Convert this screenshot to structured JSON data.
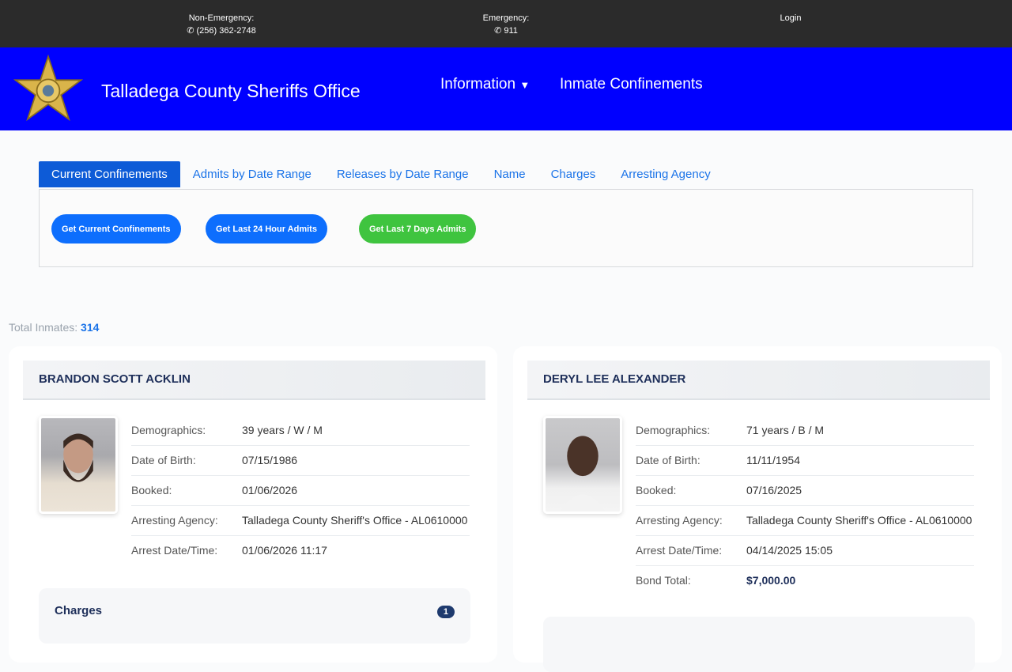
{
  "topbar": {
    "non_emergency_label": "Non-Emergency:",
    "non_emergency_phone": "(256) 362-2748",
    "emergency_label": "Emergency:",
    "emergency_phone": "911",
    "login": "Login"
  },
  "header": {
    "title": "Talladega County Sheriffs Office",
    "nav": [
      "Information",
      "Inmate Confinements"
    ]
  },
  "tabs": [
    "Current Confinements",
    "Admits by Date Range",
    "Releases by Date Range",
    "Name",
    "Charges",
    "Arresting Agency"
  ],
  "buttons": [
    {
      "label": "Get Current Confinements",
      "color": "#0d6efd"
    },
    {
      "label": "Get Last 24 Hour Admits",
      "color": "#0d6efd"
    },
    {
      "label": "Get Last 7 Days Admits",
      "color": "#3fc43f"
    }
  ],
  "total": {
    "label": "Total Inmates:",
    "value": "314"
  },
  "inmates": [
    {
      "name": "BRANDON SCOTT ACKLIN",
      "rows": [
        {
          "label": "Demographics:",
          "value": "39 years / W / M"
        },
        {
          "label": "Date of Birth:",
          "value": "07/15/1986"
        },
        {
          "label": "Booked:",
          "value": "01/06/2026"
        },
        {
          "label": "Arresting Agency:",
          "value": "Talladega County Sheriff's Office - AL0610000"
        },
        {
          "label": "Arrest Date/Time:",
          "value": "01/06/2026 11:17"
        }
      ],
      "charges_label": "Charges",
      "charges_count": "1"
    },
    {
      "name": "DERYL LEE ALEXANDER",
      "rows": [
        {
          "label": "Demographics:",
          "value": "71 years / B / M"
        },
        {
          "label": "Date of Birth:",
          "value": "11/11/1954"
        },
        {
          "label": "Booked:",
          "value": "07/16/2025"
        },
        {
          "label": "Arresting Agency:",
          "value": "Talladega County Sheriff's Office - AL0610000"
        },
        {
          "label": "Arrest Date/Time:",
          "value": "04/14/2025 15:05"
        },
        {
          "label": "Bond Total:",
          "value": "$7,000.00"
        }
      ]
    }
  ]
}
